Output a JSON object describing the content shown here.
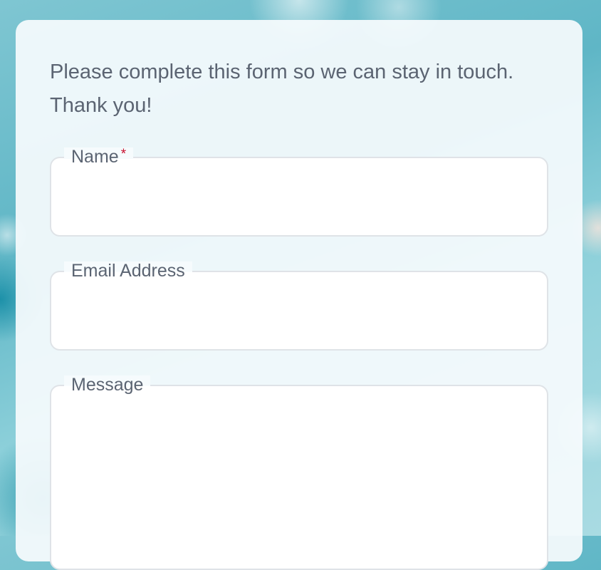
{
  "form": {
    "intro": "Please complete this form so we can stay in touch. Thank you!",
    "fields": [
      {
        "label": "Name",
        "required_mark": "*",
        "value": ""
      },
      {
        "label": "Email Address",
        "value": ""
      },
      {
        "label": "Message",
        "value": ""
      }
    ]
  },
  "colors": {
    "required": "#c8102e",
    "text": "#5b6472",
    "field_border": "#dfe3e7"
  }
}
